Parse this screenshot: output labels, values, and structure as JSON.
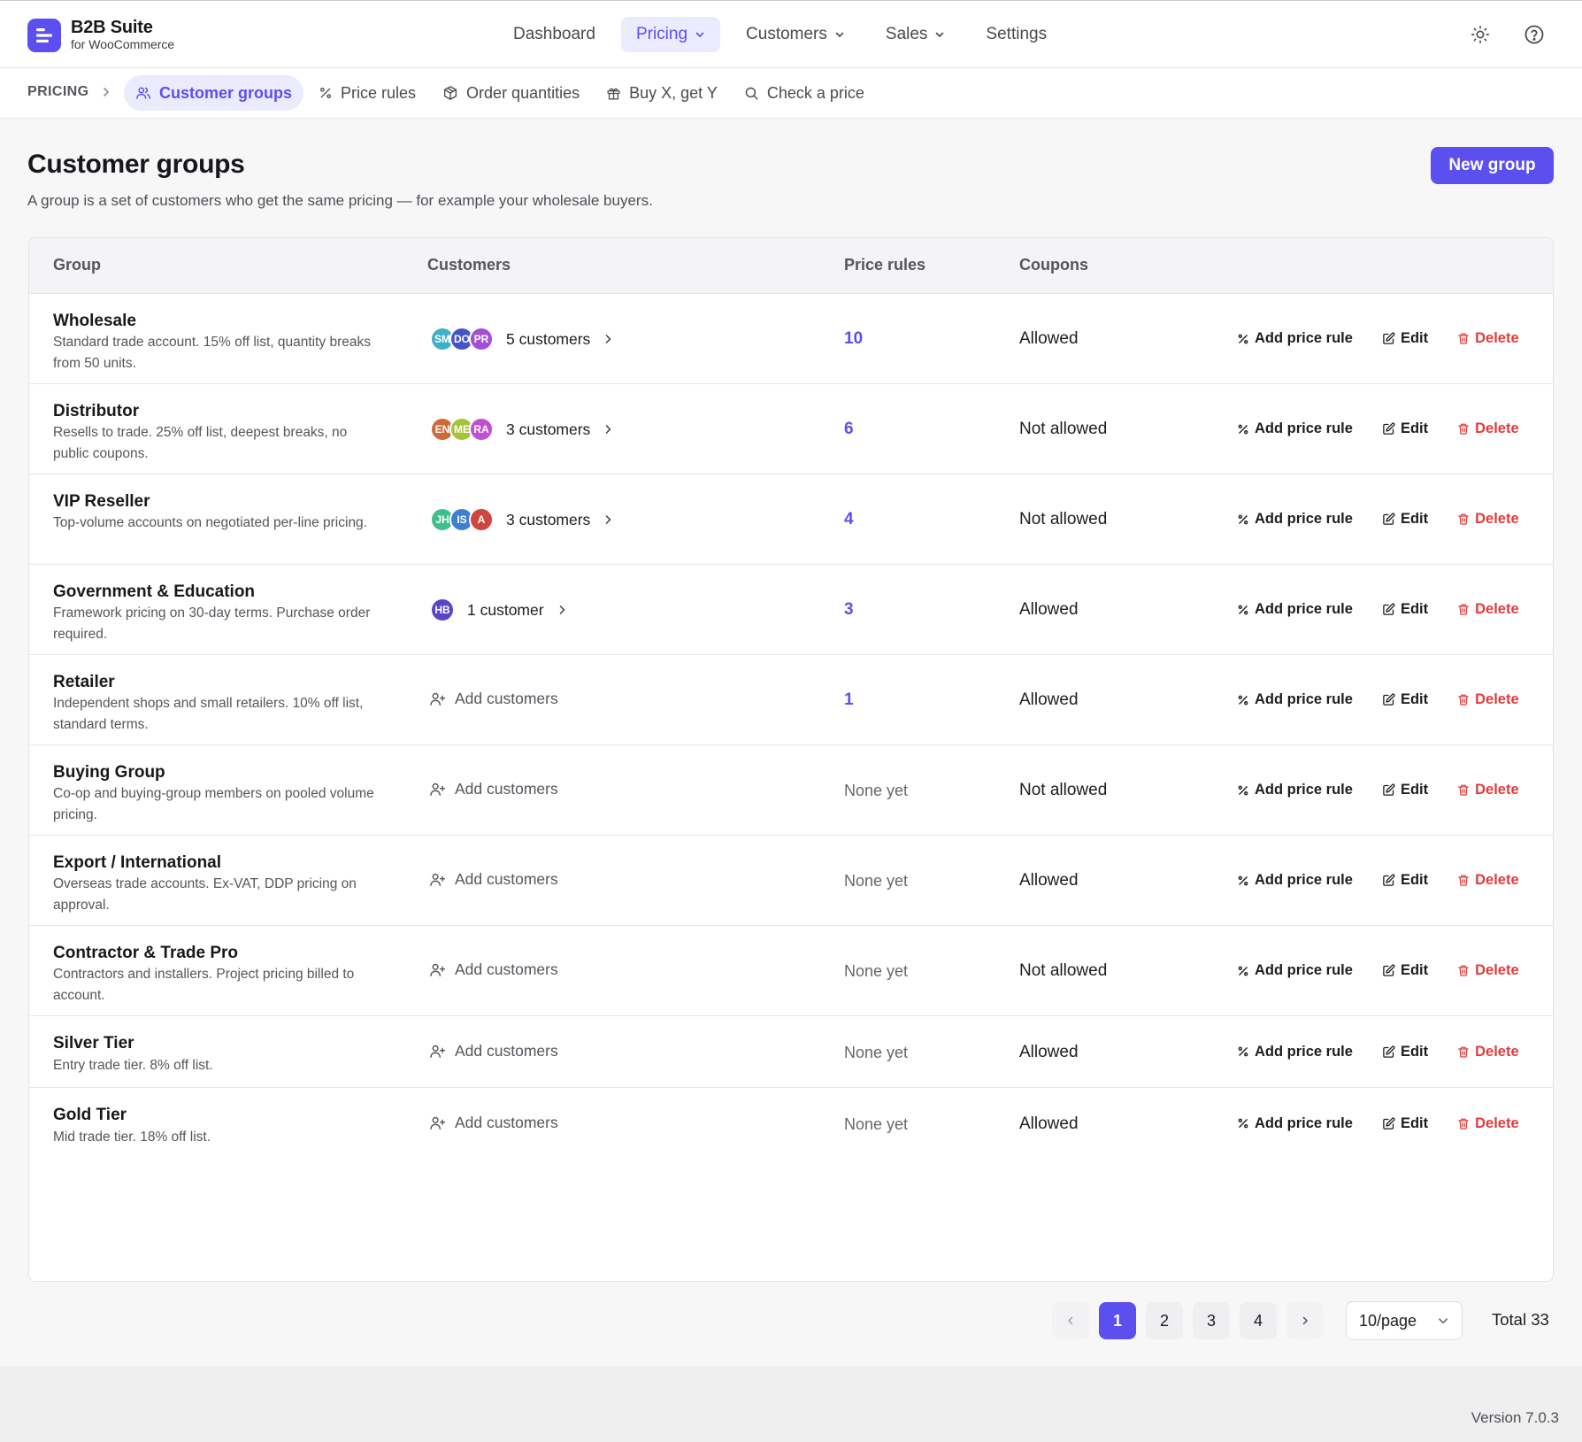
{
  "brand": {
    "name": "B2B Suite",
    "sub": "for WooCommerce"
  },
  "nav": [
    {
      "label": "Dashboard",
      "dropdown": false,
      "active": false
    },
    {
      "label": "Pricing",
      "dropdown": true,
      "active": true
    },
    {
      "label": "Customers",
      "dropdown": true,
      "active": false
    },
    {
      "label": "Sales",
      "dropdown": true,
      "active": false
    },
    {
      "label": "Settings",
      "dropdown": false,
      "active": false
    }
  ],
  "subnav": {
    "crumb": "PRICING",
    "tabs": [
      {
        "label": "Customer groups",
        "icon": "users-icon",
        "active": true
      },
      {
        "label": "Price rules",
        "icon": "percent-icon",
        "active": false
      },
      {
        "label": "Order quantities",
        "icon": "box-icon",
        "active": false
      },
      {
        "label": "Buy X, get Y",
        "icon": "gift-icon",
        "active": false
      },
      {
        "label": "Check a price",
        "icon": "search-icon",
        "active": false
      }
    ]
  },
  "page": {
    "title": "Customer groups",
    "description": "A group is a set of customers who get the same pricing — for example your wholesale buyers.",
    "new_button": "New group"
  },
  "table": {
    "headers": {
      "group": "Group",
      "customers": "Customers",
      "price_rules": "Price rules",
      "coupons": "Coupons"
    },
    "actions": {
      "add_rule": "Add price rule",
      "edit": "Edit",
      "delete": "Delete"
    },
    "add_customers": "Add customers",
    "rows": [
      {
        "name": "Wholesale",
        "desc": "Standard trade account. 15% off list, quantity breaks from 50 units.",
        "customers": "5 customers",
        "avatars": [
          {
            "t": "SM",
            "c": "#3fb0c9"
          },
          {
            "t": "DO",
            "c": "#4654c9"
          },
          {
            "t": "PR",
            "c": "#a24fd6"
          }
        ],
        "rules": "10",
        "coupons": "Allowed"
      },
      {
        "name": "Distributor",
        "desc": "Resells to trade. 25% off list, deepest breaks, no public coupons.",
        "customers": "3 customers",
        "avatars": [
          {
            "t": "EN",
            "c": "#d0693a"
          },
          {
            "t": "ME",
            "c": "#a6c23a"
          },
          {
            "t": "RA",
            "c": "#c24fd0"
          }
        ],
        "rules": "6",
        "coupons": "Not allowed"
      },
      {
        "name": "VIP Reseller",
        "desc": "Top-volume accounts on negotiated per-line pricing.",
        "customers": "3 customers",
        "avatars": [
          {
            "t": "JH",
            "c": "#3fc08a"
          },
          {
            "t": "IS",
            "c": "#3f7fd0"
          },
          {
            "t": "A",
            "c": "#d0453f"
          }
        ],
        "rules": "4",
        "coupons": "Not allowed"
      },
      {
        "name": "Government & Education",
        "desc": "Framework pricing on 30-day terms. Purchase order required.",
        "customers": "1 customer",
        "avatars": [
          {
            "t": "HB",
            "c": "#5a45c9"
          }
        ],
        "rules": "3",
        "coupons": "Allowed"
      },
      {
        "name": "Retailer",
        "desc": "Independent shops and small retailers. 10% off list, standard terms.",
        "customers": "",
        "avatars": [],
        "rules": "1",
        "coupons": "Allowed"
      },
      {
        "name": "Buying Group",
        "desc": "Co-op and buying-group members on pooled volume pricing.",
        "customers": "",
        "avatars": [],
        "rules": "None yet",
        "coupons": "Not allowed"
      },
      {
        "name": "Export / International",
        "desc": "Overseas trade accounts. Ex-VAT, DDP pricing on approval.",
        "customers": "",
        "avatars": [],
        "rules": "None yet",
        "coupons": "Allowed"
      },
      {
        "name": "Contractor & Trade Pro",
        "desc": "Contractors and installers. Project pricing billed to account.",
        "customers": "",
        "avatars": [],
        "rules": "None yet",
        "coupons": "Not allowed"
      },
      {
        "name": "Silver Tier",
        "desc": "Entry trade tier. 8% off list.",
        "customers": "",
        "avatars": [],
        "rules": "None yet",
        "coupons": "Allowed"
      },
      {
        "name": "Gold Tier",
        "desc": "Mid trade tier. 18% off list.",
        "customers": "",
        "avatars": [],
        "rules": "None yet",
        "coupons": "Allowed"
      }
    ]
  },
  "pagination": {
    "pages": [
      "1",
      "2",
      "3",
      "4"
    ],
    "current": "1",
    "per_page": "10/page",
    "total": "Total 33"
  },
  "footer": {
    "version": "Version 7.0.3"
  },
  "colors": {
    "accent": "#5b4ff0",
    "danger": "#e23b3b"
  }
}
